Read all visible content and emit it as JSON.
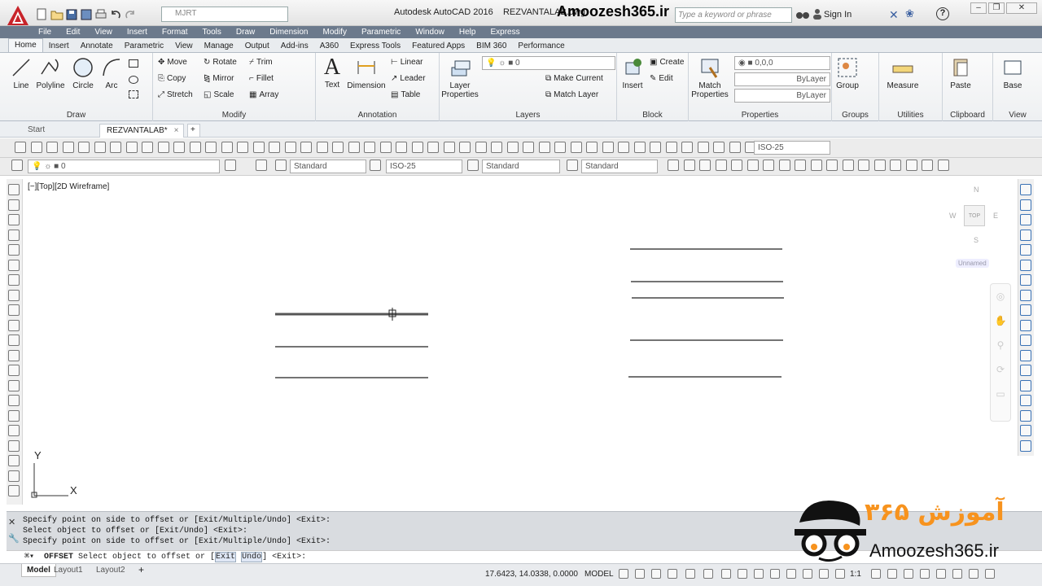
{
  "app": {
    "name": "Autodesk AutoCAD 2016",
    "file": "REZVANTALAB.dwg",
    "watermark": "Amoozesh365.ir"
  },
  "workspace": {
    "value": "MJRT"
  },
  "search": {
    "placeholder": "Type a keyword or phrase"
  },
  "account": {
    "signin": "Sign In"
  },
  "menu": [
    "File",
    "Edit",
    "View",
    "Insert",
    "Format",
    "Tools",
    "Draw",
    "Dimension",
    "Modify",
    "Parametric",
    "Window",
    "Help",
    "Express"
  ],
  "ribbon_tabs": [
    "Home",
    "Insert",
    "Annotate",
    "Parametric",
    "View",
    "Manage",
    "Output",
    "Add-ins",
    "A360",
    "Express Tools",
    "Featured Apps",
    "BIM 360",
    "Performance"
  ],
  "ribbon": {
    "draw": {
      "title": "Draw",
      "line": "Line",
      "polyline": "Polyline",
      "circle": "Circle",
      "arc": "Arc"
    },
    "modify": {
      "title": "Modify",
      "move": "Move",
      "rotate": "Rotate",
      "trim": "Trim",
      "copy": "Copy",
      "mirror": "Mirror",
      "fillet": "Fillet",
      "stretch": "Stretch",
      "scale": "Scale",
      "array": "Array"
    },
    "annotation": {
      "title": "Annotation",
      "text": "Text",
      "dimension": "Dimension",
      "linear": "Linear",
      "leader": "Leader",
      "table": "Table"
    },
    "layers": {
      "title": "Layers",
      "layer_properties": "Layer Properties",
      "current_layer": "0",
      "make_current": "Make Current",
      "match_layer": "Match Layer"
    },
    "block": {
      "title": "Block",
      "insert": "Insert",
      "create": "Create",
      "edit": "Edit"
    },
    "properties": {
      "title": "Properties",
      "match_properties": "Match Properties",
      "color_value": "0,0,0",
      "linetype": "ByLayer",
      "lineweight": "ByLayer"
    },
    "groups": {
      "title": "Groups",
      "group": "Group"
    },
    "utilities": {
      "title": "Utilities",
      "measure": "Measure"
    },
    "clipboard": {
      "title": "Clipboard",
      "paste": "Paste"
    },
    "view": {
      "title": "View",
      "base": "Base"
    }
  },
  "doc_tabs": {
    "start": "Start",
    "active": "REZVANTALAB*"
  },
  "toolbars": {
    "dimstyle": "ISO-25",
    "layer": "0",
    "textstyle": "Standard",
    "dimstyle2": "ISO-25",
    "tablestyle": "Standard",
    "mleaderstyle": "Standard"
  },
  "viewport": {
    "label": "[−][Top][2D Wireframe]",
    "ucs_y": "Y",
    "ucs_x": "X"
  },
  "viewcube": {
    "north": "N",
    "south": "S",
    "east": "E",
    "west": "W",
    "face": "TOP",
    "ucs_name": "Unnamed"
  },
  "command_history": [
    "Specify point on side to offset or [Exit/Multiple/Undo] <Exit>:",
    "Select object to offset or [Exit/Undo] <Exit>:",
    "Specify point on side to offset or [Exit/Multiple/Undo] <Exit>:"
  ],
  "command_prompt": {
    "command": "OFFSET",
    "text": " Select object to offset or [",
    "opt1": "Exit",
    "opt2": "Undo",
    "tail": "] <Exit>:"
  },
  "status": {
    "coords": "17.6423, 14.0338, 0.0000",
    "space": "MODEL",
    "scale": "1:1"
  },
  "layout_tabs": [
    "Model",
    "Layout1",
    "Layout2"
  ],
  "logo": {
    "persian": "آموزش ۳۶۵",
    "site": "Amoozesh365.ir"
  },
  "colors": {
    "accent": "#c8242a",
    "menubar": "#6c7a8c",
    "brand_orange": "#f7931e"
  }
}
